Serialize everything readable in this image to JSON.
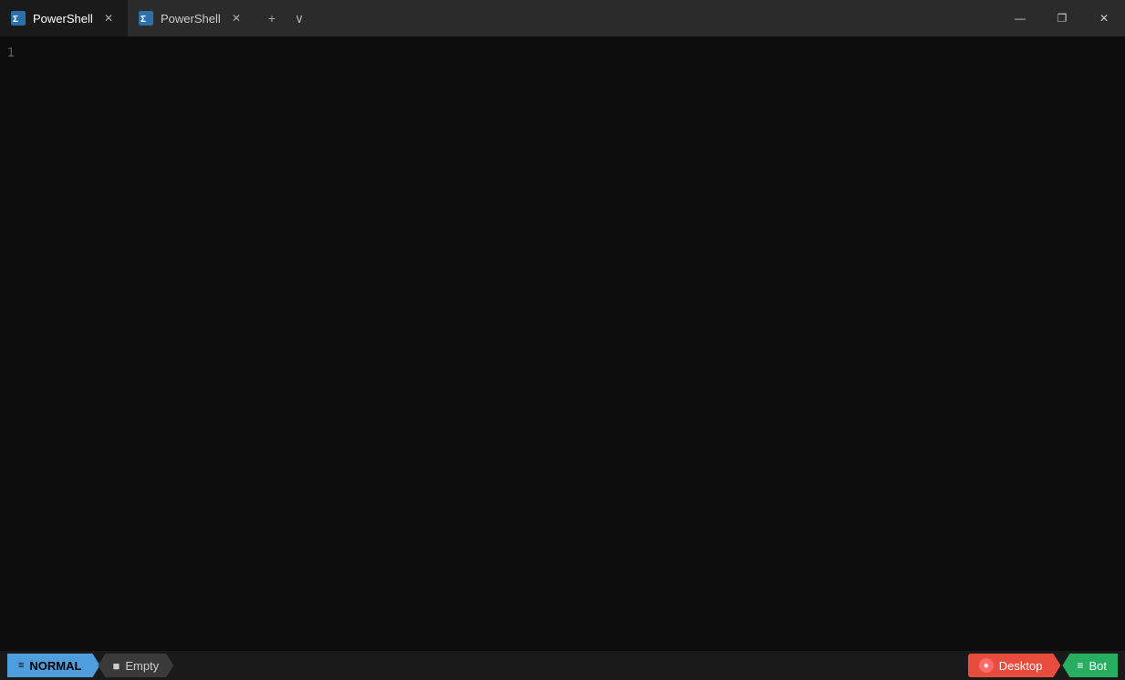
{
  "titlebar": {
    "tab1": {
      "label": "PowerShell",
      "active": true
    },
    "tab2": {
      "label": "PowerShell",
      "active": false
    },
    "new_tab_label": "+",
    "dropdown_label": "∨"
  },
  "window_controls": {
    "minimize": "—",
    "maximize": "❐",
    "close": "✕"
  },
  "terminal": {
    "line_number": "1"
  },
  "statusbar": {
    "mode": "NORMAL",
    "mode_icon": "≡",
    "file_icon": "■",
    "file_label": "Empty",
    "desktop_label": "Desktop",
    "desktop_icon": "●",
    "bot_label": "Bot",
    "bot_icon": "≡"
  }
}
